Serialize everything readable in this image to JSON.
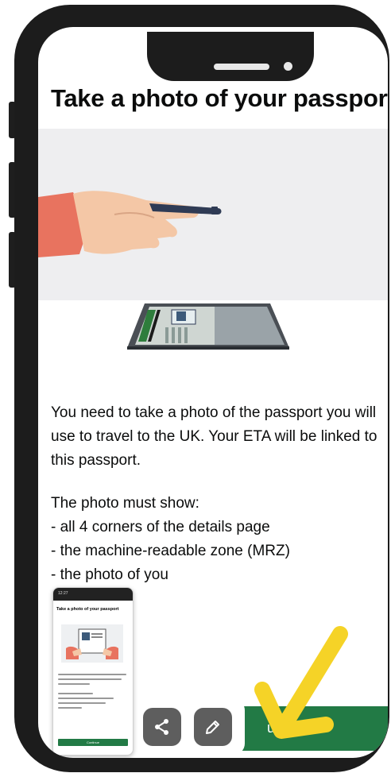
{
  "page": {
    "title": "Take a photo of your passport",
    "intro": "You need to take a photo of the passport you will use to travel to the UK. Your ETA will be linked to this passport.",
    "must_show_heading": "The photo must show:",
    "must_show_items": [
      "- all 4 corners of the details page",
      "- the machine-readable zone (MRZ)",
      "- the photo of you"
    ],
    "continue_label": "Continue",
    "continue_visible_text": "ue"
  },
  "thumbnail": {
    "status_time": "12:27",
    "title": "Take a photo of your passport",
    "button_label": "Continue"
  },
  "actions": {
    "share_icon": "share-icon",
    "edit_icon": "pencil-icon"
  },
  "colors": {
    "continue_green": "#227a45",
    "arrow_yellow": "#f5d327",
    "sleeve": "#e8735f",
    "skin": "#f4c7a6",
    "phone_frame": "#1c1c1c",
    "action_button": "#5e5e5e"
  }
}
